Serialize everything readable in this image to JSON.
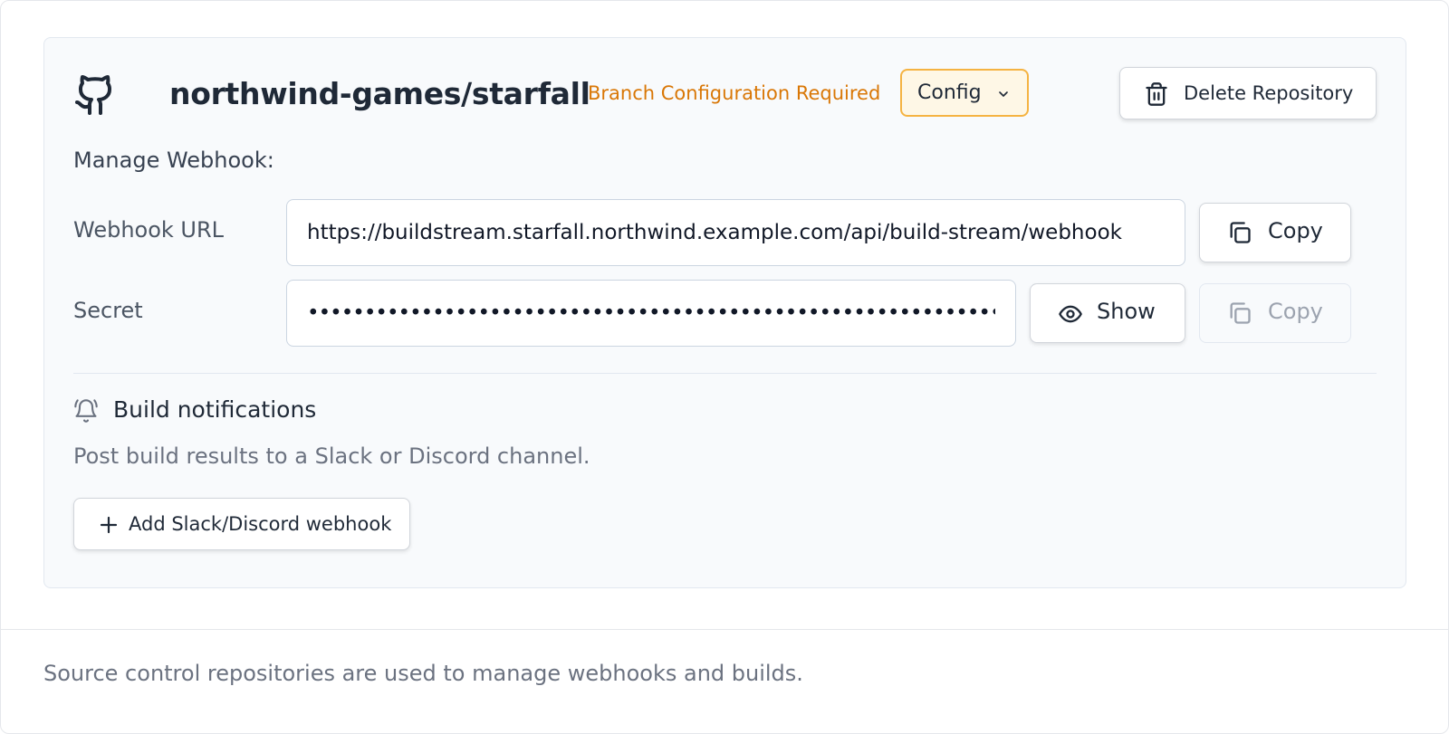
{
  "repository": {
    "name": "northwind-games/starfall",
    "status_text": "Branch Configuration Required",
    "config_label": "Config",
    "delete_label": "Delete Repository",
    "icon": "github-icon"
  },
  "webhook": {
    "section_label": "Manage Webhook:",
    "url_label": "Webhook URL",
    "url_value": "https://buildstream.starfall.northwind.example.com/api/build-stream/webhook",
    "url_copy_label": "Copy",
    "secret_label": "Secret",
    "secret_value": "••••••••••••••••••••••••••••••••••••••••••••••••••••••••••••••••",
    "show_label": "Show",
    "secret_copy_label": "Copy"
  },
  "notifications": {
    "title": "Build notifications",
    "description": "Post build results to a Slack or Discord channel.",
    "add_label": "Add Slack/Discord webhook"
  },
  "footer": {
    "text": "Source control repositories are used to manage webhooks and builds."
  },
  "colors": {
    "warning": "#d97706",
    "config_bg": "#fef7e6",
    "config_border": "#f5b342",
    "card_bg": "#f8fafc"
  }
}
